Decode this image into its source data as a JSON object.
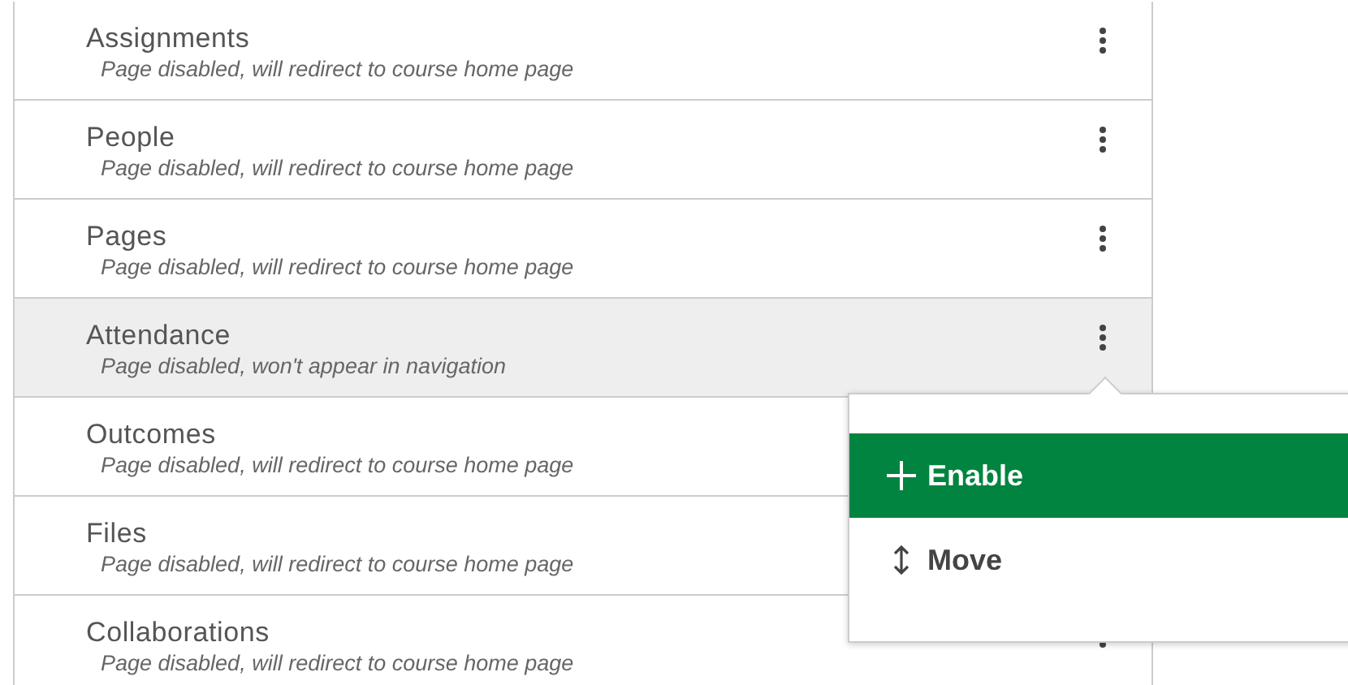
{
  "nav_items": [
    {
      "title": "Assignments",
      "note": "Page disabled, will redirect to course home page",
      "selected": false
    },
    {
      "title": "People",
      "note": "Page disabled, will redirect to course home page",
      "selected": false
    },
    {
      "title": "Pages",
      "note": "Page disabled, will redirect to course home page",
      "selected": false
    },
    {
      "title": "Attendance",
      "note": "Page disabled, won't appear in navigation",
      "selected": true
    },
    {
      "title": "Outcomes",
      "note": "Page disabled, will redirect to course home page",
      "selected": false
    },
    {
      "title": "Files",
      "note": "Page disabled, will redirect to course home page",
      "selected": false
    },
    {
      "title": "Collaborations",
      "note": "Page disabled, will redirect to course home page",
      "selected": false
    }
  ],
  "menu": {
    "items": [
      {
        "kind": "plus",
        "label": "Enable",
        "selected": true
      },
      {
        "kind": "move",
        "label": "Move",
        "selected": false
      }
    ]
  }
}
